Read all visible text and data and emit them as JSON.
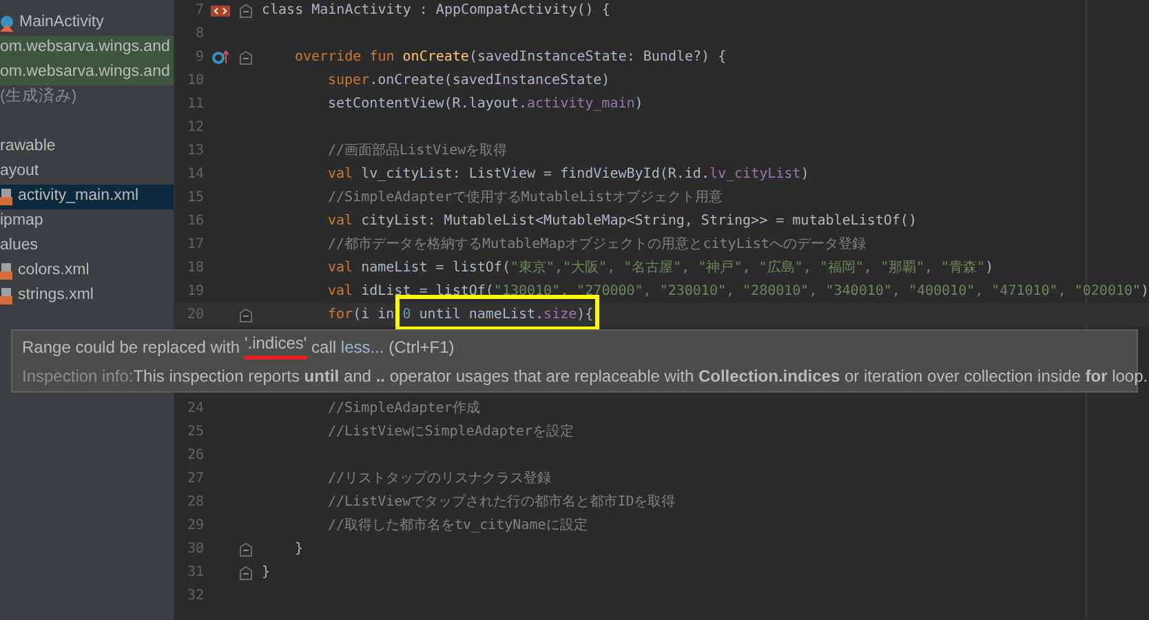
{
  "project_tree": [
    {
      "label": "MainActivity",
      "kind": "class",
      "highlighted": false,
      "selected": false
    },
    {
      "label": "om.websarva.wings.and",
      "kind": "package",
      "highlighted": true,
      "selected": false
    },
    {
      "label": "om.websarva.wings.and",
      "kind": "package",
      "highlighted": true,
      "selected": false
    },
    {
      "label": "(生成済み)",
      "kind": "note",
      "highlighted": false,
      "selected": false
    },
    {
      "label": "rawable",
      "kind": "section",
      "highlighted": false,
      "selected": false
    },
    {
      "label": "ayout",
      "kind": "folder",
      "highlighted": false,
      "selected": false
    },
    {
      "label": "activity_main.xml",
      "kind": "xml",
      "highlighted": false,
      "selected": true
    },
    {
      "label": "ipmap",
      "kind": "folder",
      "highlighted": false,
      "selected": false
    },
    {
      "label": "alues",
      "kind": "folder",
      "highlighted": false,
      "selected": false
    },
    {
      "label": "colors.xml",
      "kind": "xml",
      "highlighted": false,
      "selected": false
    },
    {
      "label": "strings.xml",
      "kind": "xml",
      "highlighted": false,
      "selected": false
    }
  ],
  "editor": {
    "lines": [
      {
        "number": "7",
        "kind": "class",
        "fold": true,
        "current": false,
        "tokens": [
          {
            "text": "class MainActivity : AppCompatActivity() {",
            "kind": "plain"
          }
        ],
        "children": [
          {
            "number": "8",
            "kind": "code",
            "fold": false,
            "current": false
          },
          {
            "number": "9",
            "kind": "override",
            "fold": true,
            "current": false,
            "tokens": [
              {
                "text": "override fun ",
                "kind": "kw"
              },
              {
                "text": "onCreate",
                "kind": "fn"
              },
              {
                "text": "(savedInstanceState: Bundle?) {",
                "kind": "plain"
              }
            ],
            "children": [
              {
                "number": "10",
                "kind": "code",
                "fold": false,
                "current": false,
                "tokens": [
                  {
                    "text": "super",
                    "kind": "kw"
                  },
                  {
                    "text": ".onCreate(savedInstanceState)",
                    "kind": "plain"
                  }
                ]
              },
              {
                "number": "11",
                "kind": "code",
                "fold": false,
                "current": false,
                "tokens": [
                  {
                    "text": "setContentView(R.layout.",
                    "kind": "plain"
                  },
                  {
                    "text": "activity_main",
                    "kind": "prop"
                  },
                  {
                    "text": ")",
                    "kind": "plain"
                  }
                ]
              },
              {
                "number": "12",
                "kind": "code",
                "fold": false,
                "current": false
              },
              {
                "number": "13",
                "kind": "code",
                "fold": false,
                "current": false,
                "tokens": [
                  {
                    "text": "//画面部品ListViewを取得",
                    "kind": "com"
                  }
                ]
              },
              {
                "number": "14",
                "kind": "code",
                "fold": false,
                "current": false,
                "tokens": [
                  {
                    "text": "val ",
                    "kind": "kw"
                  },
                  {
                    "text": "lv_cityList",
                    "kind": "plain"
                  },
                  {
                    "text": ": ListView = findViewById(R.id.",
                    "kind": "plain"
                  },
                  {
                    "text": "lv_cityList",
                    "kind": "prop"
                  },
                  {
                    "text": ")",
                    "kind": "plain"
                  }
                ]
              },
              {
                "number": "15",
                "kind": "code",
                "fold": false,
                "current": false,
                "tokens": [
                  {
                    "text": "//SimpleAdapterで使用するMutableListオブジェクト用意",
                    "kind": "com"
                  }
                ]
              },
              {
                "number": "16",
                "kind": "code",
                "fold": false,
                "current": false,
                "tokens": [
                  {
                    "text": "val ",
                    "kind": "kw"
                  },
                  {
                    "text": "cityList: MutableList<MutableMap<String, String>> = mutableListOf()",
                    "kind": "plain"
                  }
                ]
              },
              {
                "number": "17",
                "kind": "code",
                "fold": false,
                "current": false,
                "tokens": [
                  {
                    "text": "//都市データを格納するMutableMapオブジェクトの用意とcityListへのデータ登録",
                    "kind": "com"
                  }
                ]
              },
              {
                "number": "18",
                "kind": "code",
                "fold": false,
                "current": false,
                "tokens": [
                  {
                    "text": "val ",
                    "kind": "kw"
                  },
                  {
                    "text": "nameList = listOf(",
                    "kind": "plain"
                  },
                  {
                    "text": "\"東京\",\"大阪\", \"名古屋\", \"神戸\", \"広島\", \"福岡\", \"那覇\", \"青森\"",
                    "kind": "str"
                  },
                  {
                    "text": ")",
                    "kind": "plain"
                  }
                ]
              },
              {
                "number": "19",
                "kind": "code",
                "fold": false,
                "current": false,
                "tokens": [
                  {
                    "text": "val ",
                    "kind": "kw"
                  },
                  {
                    "text": "idList = listOf(",
                    "kind": "plain"
                  },
                  {
                    "text": "\"130010\", \"270000\", \"230010\", \"280010\", \"340010\", \"400010\", \"471010\", \"020010\"",
                    "kind": "str"
                  },
                  {
                    "text": ")",
                    "kind": "plain"
                  }
                ]
              },
              {
                "number": "20",
                "kind": "code",
                "fold": true,
                "current": true,
                "tokens": [
                  {
                    "text": "for",
                    "kind": "kw"
                  },
                  {
                    "text": "(i in ",
                    "kind": "plain"
                  },
                  {
                    "text": "0",
                    "kind": "num"
                  },
                  {
                    "text": " until nameList.",
                    "kind": "plain"
                  },
                  {
                    "text": "size",
                    "kind": "prop"
                  },
                  {
                    "text": "){",
                    "kind": "plain"
                  }
                ],
                "tooltip": {
                  "message": "Range could be replaced with ",
                  "quoted": "'.indices'",
                  "after": " call",
                  "link": "less...",
                  "shortcut": "(Ctrl+F1)",
                  "info_label": "Inspection info:",
                  "info": "This inspection reports **until** and **..** operator usages that are replaceable with **Collection.indices** or iteration over collection inside **for** loop."
                }
              },
              {
                "number": "24",
                "kind": "code",
                "fold": false,
                "current": false,
                "tokens": [
                  {
                    "text": "//SimpleAdapter作成",
                    "kind": "com"
                  }
                ]
              },
              {
                "number": "25",
                "kind": "code",
                "fold": false,
                "current": false,
                "tokens": [
                  {
                    "text": "//ListViewにSimpleAdapterを設定",
                    "kind": "com"
                  }
                ]
              },
              {
                "number": "26",
                "kind": "code",
                "fold": false,
                "current": false
              },
              {
                "number": "27",
                "kind": "code",
                "fold": false,
                "current": false,
                "tokens": [
                  {
                    "text": "//リストタップのリスナクラス登録",
                    "kind": "com"
                  }
                ]
              },
              {
                "number": "28",
                "kind": "code",
                "fold": false,
                "current": false,
                "tokens": [
                  {
                    "text": "//ListViewでタップされた行の都市名と都市IDを取得",
                    "kind": "com"
                  }
                ]
              },
              {
                "number": "29",
                "kind": "code",
                "fold": false,
                "current": false,
                "tokens": [
                  {
                    "text": "//取得した都市名をtv_cityNameに設定",
                    "kind": "com"
                  }
                ]
              }
            ]
          },
          {
            "number": "30",
            "kind": "code",
            "fold": true,
            "current": false,
            "tokens": [
              {
                "text": "}",
                "kind": "plain"
              }
            ]
          }
        ]
      },
      {
        "number": "31",
        "kind": "code",
        "fold": true,
        "current": false,
        "tokens": [
          {
            "text": "}",
            "kind": "plain"
          }
        ]
      },
      {
        "number": "32",
        "kind": "code",
        "fold": false,
        "current": false
      }
    ]
  }
}
